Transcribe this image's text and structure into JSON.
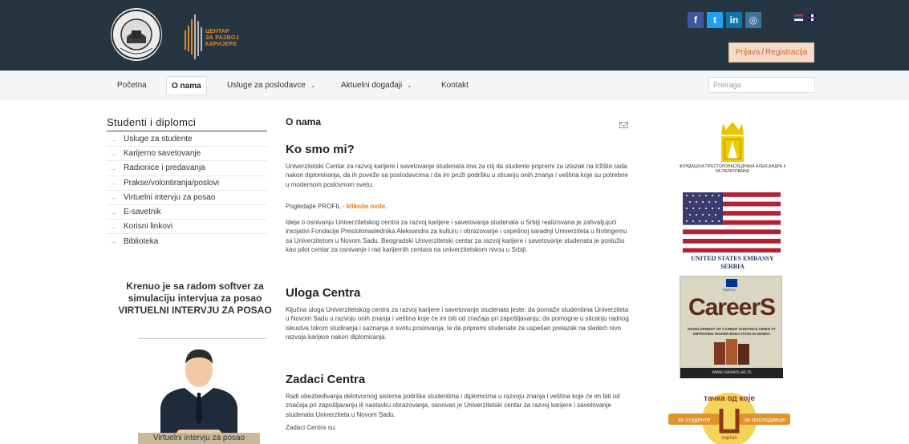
{
  "header": {
    "logo_seal_text": "UNIVERSITAS STUDIORUM NEOPLANTENSIS",
    "logo_cz_lines": [
      "ЦЕНТАР",
      "ЗА РАЗВОЈ",
      "КАРИЈЕРЕ"
    ],
    "social": [
      {
        "name": "facebook",
        "glyph": "f",
        "color": "#3b5998"
      },
      {
        "name": "twitter",
        "glyph": "t",
        "color": "#1da1f2"
      },
      {
        "name": "linkedin",
        "glyph": "in",
        "color": "#0e76a8"
      },
      {
        "name": "instagram",
        "glyph": "◎",
        "color": "#3f729b"
      }
    ],
    "login": "Prijava",
    "login_sep": "/",
    "register": "Registracija"
  },
  "nav": {
    "items": [
      {
        "label": "Početna"
      },
      {
        "label": "O nama"
      },
      {
        "label": "Usluge za poslodavce"
      },
      {
        "label": "Aktuelni događaji"
      },
      {
        "label": "Kontakt"
      }
    ],
    "search_placeholder": "Pretraga"
  },
  "sidebar": {
    "title": "Studenti i diplomci",
    "items": [
      {
        "label": "Usluge za studente"
      },
      {
        "label": "Karijerno savetovanje"
      },
      {
        "label": "Radionice i predavanja"
      },
      {
        "label": "Prakse/volontiranja/poslovi"
      },
      {
        "label": "Virtuelni intervju za posao"
      },
      {
        "label": "E-savetnik"
      },
      {
        "label": "Korisni linkovi"
      },
      {
        "label": "Biblioteka"
      }
    ],
    "promo_line1": "Krenuo je sa radom softver za simulaciju intervjua za posao",
    "promo_line2": "VIRTUELNI INTERVJU ZA POSAO",
    "promo_caption": "Virtuelni intervju za posao"
  },
  "main": {
    "page_title": "O nama",
    "section1_title": "Ko smo mi?",
    "section1_p1": "Univerzitetski Centar za razvoj karijere i savetovanje studenata ima za cilj da studente pripremi za izlazak na tržište rada nakon diplomiranja, da ih poveže sa poslodavcima i da im pruži podršku u sticanju onih znanja i veština koje su potrebne u modernom poslovnom svetu.",
    "profil_prefix": "Pogledajte PROFIL - ",
    "profil_link": "kliknite ovde",
    "profil_suffix": ".",
    "section1_p2": "Ideja o osnivanju Univerzitetskog centra za razvoj karijere i savetovanja studenata u Srbiji realizovana je zahvaljujući inicijativi Fondacije Prestolonaslednika Aleksandra za kulturu i obrazovanje i uspešnoj saradnji Univerziteta u Notingemu sa Univerzitetom u Novom Sadu. Beogradski Univerzitetski centar za razvoj karijere i savetovanje studenata je poslužio kao pilot centar za osnivanje i rad karijernih centara na univerzitetskom nivou u Srbiji.",
    "section2_title": "Uloga Centra",
    "section2_p1": "Ključna uloga Univerzitetskog centra za razvoj karijere i savetovanje studenata jeste: da pomaže studentima Univerziteta u Novom Sadu u razvoju onih znanja i veština koje će im biti od značaja pri zapošljavanju; da pomogne u sticanju radnog iskustva tokom studiranja i saznanja o svetu poslovanja, te da pripremi studenate za uspešan prelazak na sledeći nivo razvoja karijere nakon diplomiranja.",
    "section3_title": "Zadaci Centra",
    "section3_p1": "Radi obezbeđivanja delotvornog sistema podrške studentima i diplomcima u razvoju znanja i veština koje će im biti od značaja pri zapošljavanju ili nastavku obrazovanja, osnovan je Univerzitetski centar za razvoj karijere i savetovanje studenata Univerziteta u Novom Sadu.",
    "section3_p2": "Zadaci Centra su:"
  },
  "right": {
    "foundation_text": "ФОНДАЦИЈА ПРЕСТОЛОНАСЛЕДНИКА АЛЕКСАНДРА II ЗА ОБРАЗОВАЊЕ",
    "embassy_line1": "UNITED STATES EMBASSY",
    "embassy_line2": "SERBIA",
    "careers_tempus": "TEMPUS",
    "careers_title": "CareerS",
    "careers_sub": "DEVELOPMENT OF CAREER GUIDANCE AIMED AT IMPROVING HIGHER EDUCATION IN SERBIA",
    "careers_url": "www.careers.ac.rs",
    "tacka_top": "тачка од које",
    "tacka_left": "за студенте",
    "tacka_right": "за послодавце",
    "tacka_bottom": "портал"
  }
}
